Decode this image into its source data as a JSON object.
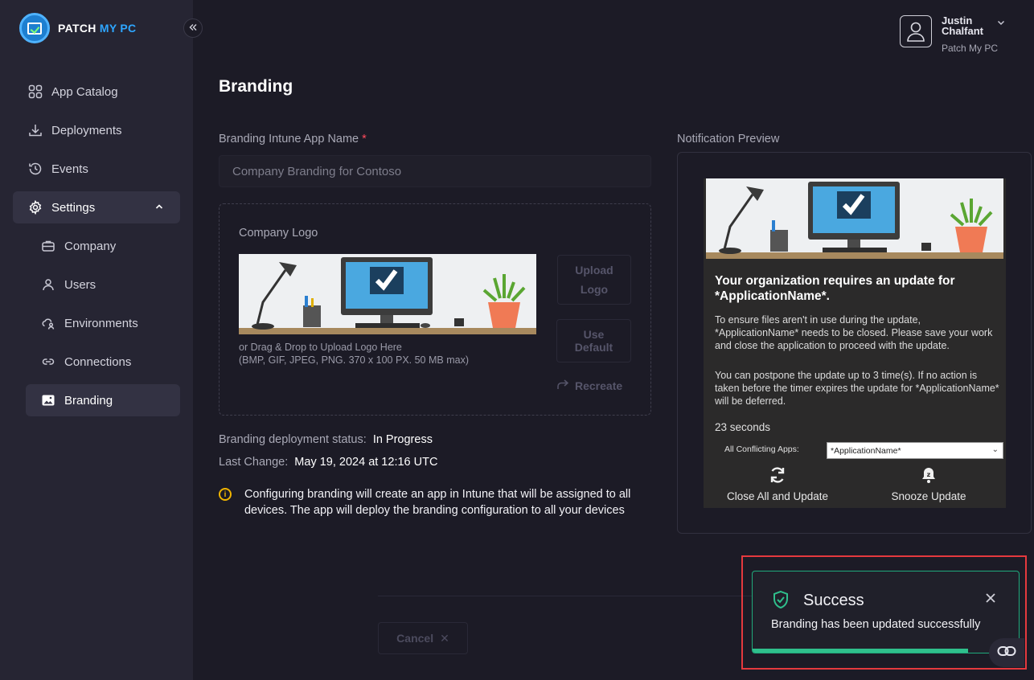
{
  "brand": {
    "word1": "PATCH",
    "word2": "MY PC",
    "icon": "patchmypc-logo-icon"
  },
  "sidebar": {
    "collapse_icon": "double-chevron-left-icon",
    "items": [
      {
        "label": "App Catalog",
        "icon": "grid-icon"
      },
      {
        "label": "Deployments",
        "icon": "download-icon"
      },
      {
        "label": "Events",
        "icon": "history-icon"
      },
      {
        "label": "Settings",
        "icon": "gear-icon",
        "expanded": true
      },
      {
        "label": "Company",
        "icon": "briefcase-icon"
      },
      {
        "label": "Users",
        "icon": "user-icon"
      },
      {
        "label": "Environments",
        "icon": "cloud-user-icon"
      },
      {
        "label": "Connections",
        "icon": "link-icon"
      },
      {
        "label": "Branding",
        "icon": "image-icon",
        "active": true
      }
    ]
  },
  "user": {
    "name": "Justin Chalfant",
    "org": "Patch My PC"
  },
  "page": {
    "title": "Branding"
  },
  "form": {
    "app_name_label": "Branding Intune App Name",
    "required_mark": "*",
    "app_name_value": "Company Branding for Contoso",
    "logo_label": "Company Logo",
    "upload_hint": "or Drag & Drop to Upload Logo Here",
    "upload_formats": "(BMP, GIF, JPEG, PNG. 370 x 100 PX. 50 MB max)",
    "upload_button": "Upload Logo",
    "default_button": "Use Default",
    "recreate_button": "Recreate"
  },
  "status": {
    "deploy_label": "Branding deployment status:",
    "deploy_value": "In Progress",
    "change_label": "Last Change:",
    "change_value": "May 19, 2024 at 12:16 UTC"
  },
  "info": {
    "text": "Configuring branding will create an app in Intune that will be assigned to all devices. The app will deploy the branding configuration to all your devices"
  },
  "preview": {
    "label": "Notification Preview",
    "title": "Your organization requires an update for *ApplicationName*.",
    "body1": "To ensure files aren't in use during the update, *ApplicationName* needs to be closed. Please save your work and close the application to proceed with the update.",
    "body2": "You can postpone the update up to 3 time(s). If no action is taken before the timer expires the update for *ApplicationName* will be deferred.",
    "seconds": "23 seconds",
    "conflicting_label": "All Conflicting Apps:",
    "conflicting_value": "*ApplicationName*",
    "action_close": "Close All and Update",
    "action_snooze": "Snooze Update"
  },
  "footer": {
    "cancel": "Cancel"
  },
  "toast": {
    "title": "Success",
    "message": "Branding has been updated successfully",
    "progress": 0.81,
    "accent": "#2fbf8c"
  },
  "colors": {
    "background": "#1c1b26",
    "sidebar": "#262533",
    "brand_blue": "#2ea6ff",
    "warning": "#f0b400",
    "highlight": "#e5393e"
  }
}
